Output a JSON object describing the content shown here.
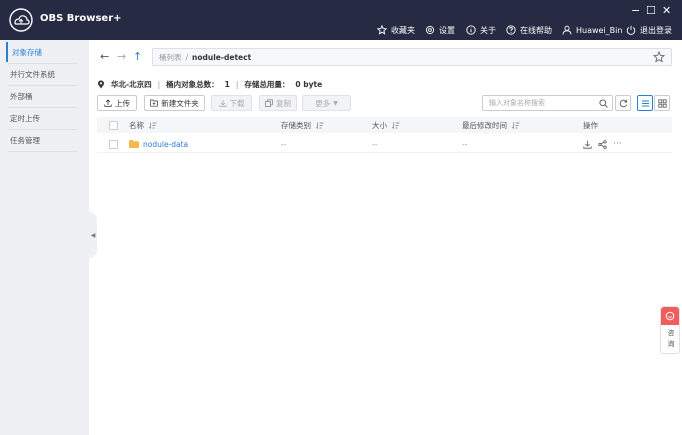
{
  "app": {
    "title": "OBS Browser+"
  },
  "window_controls": {
    "minimize": "−",
    "maximize": "☐",
    "close": "✕"
  },
  "topnav": {
    "favorites": "收藏夹",
    "settings": "设置",
    "about": "关于",
    "help": "在线帮助",
    "user": "Huawei_Bin",
    "logout": "退出登录"
  },
  "sidebar": {
    "items": [
      {
        "label": "对象存储"
      },
      {
        "label": "并行文件系统"
      },
      {
        "label": "外部桶"
      },
      {
        "label": "定时上传"
      },
      {
        "label": "任务管理"
      }
    ]
  },
  "path": {
    "root": "桶列表",
    "separator": "/",
    "current": "nodule-detect"
  },
  "info": {
    "region": "华北-北京四",
    "object_count_label": "桶内对象总数：",
    "object_count": "1",
    "usage_label": "存储总用量：",
    "usage": "0 byte",
    "divider": "|"
  },
  "toolbar": {
    "upload": "上传",
    "new_folder": "新建文件夹",
    "download": "下载",
    "copy": "复制",
    "more": "更多",
    "search_placeholder": "输入对象名称搜索"
  },
  "table": {
    "columns": [
      "名称",
      "存储类别",
      "大小",
      "最后修改时间",
      "操作"
    ],
    "rows": [
      {
        "name": "nodule-data",
        "storage_class": "--",
        "size": "--",
        "modified": "--",
        "more": "···"
      }
    ]
  },
  "float_consult": {
    "line1": "咨",
    "line2": "询"
  },
  "colors": {
    "titlebar": "#262a42",
    "accent": "#2a80d8",
    "folder": "#f5b84a",
    "consult": "#ef5d5d"
  }
}
